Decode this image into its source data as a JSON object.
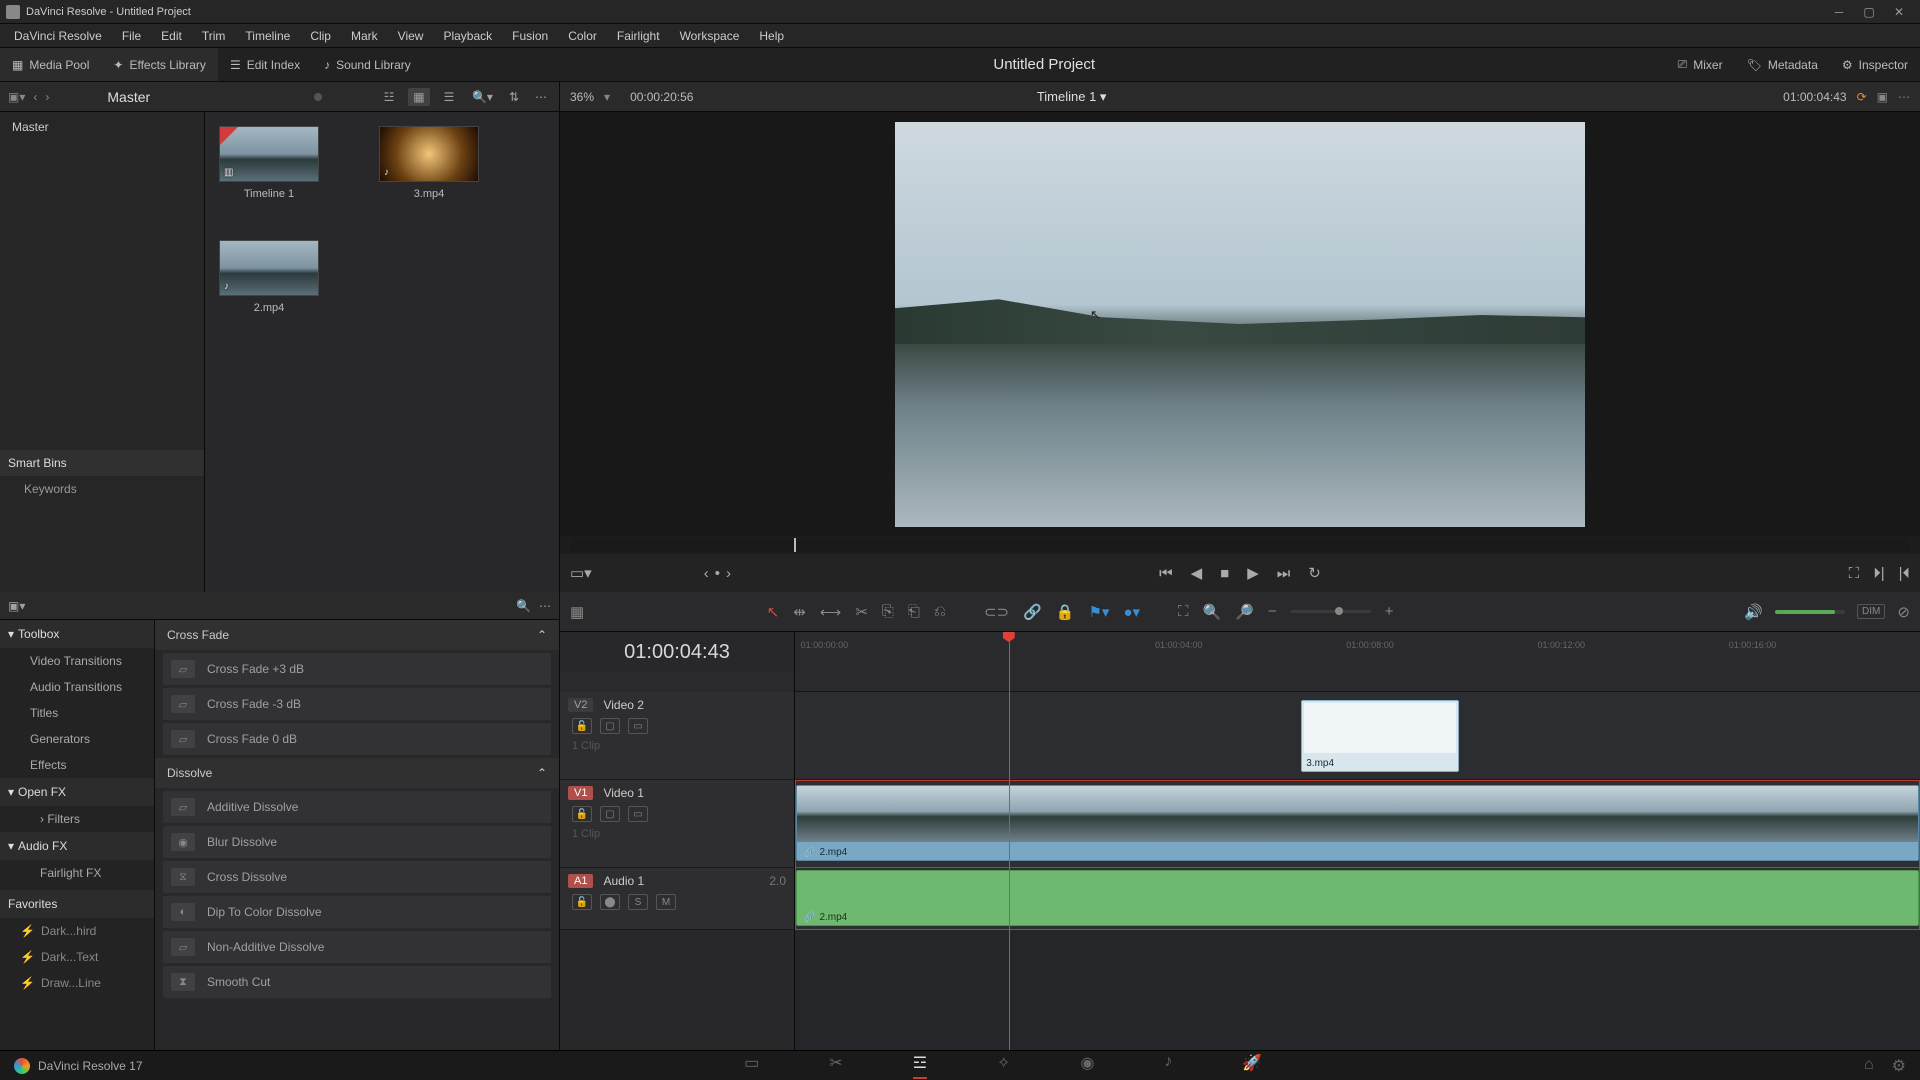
{
  "titlebar": {
    "title": "DaVinci Resolve - Untitled Project"
  },
  "menu": [
    "DaVinci Resolve",
    "File",
    "Edit",
    "Trim",
    "Timeline",
    "Clip",
    "Mark",
    "View",
    "Playback",
    "Fusion",
    "Color",
    "Fairlight",
    "Workspace",
    "Help"
  ],
  "top_toolbar": {
    "media_pool": "Media Pool",
    "effects_library": "Effects Library",
    "edit_index": "Edit Index",
    "sound_library": "Sound Library",
    "project": "Untitled Project",
    "mixer": "Mixer",
    "metadata": "Metadata",
    "inspector": "Inspector"
  },
  "media": {
    "bin": "Master",
    "master_label": "Master",
    "smart_bins": "Smart Bins",
    "keywords": "Keywords",
    "clips": [
      {
        "name": "Timeline 1",
        "kind": "timeline",
        "thumb": "lake"
      },
      {
        "name": "3.mp4",
        "kind": "av",
        "thumb": "tunnel"
      },
      {
        "name": "2.mp4",
        "kind": "av",
        "thumb": "lake"
      }
    ]
  },
  "viewer": {
    "zoom": "36%",
    "duration": "00:00:20:56",
    "timeline_name": "Timeline 1",
    "timecode": "01:00:04:43"
  },
  "fx": {
    "toolbox": "Toolbox",
    "cats": [
      "Video Transitions",
      "Audio Transitions",
      "Titles",
      "Generators",
      "Effects"
    ],
    "openfx": "Open FX",
    "openfx_sub": [
      "Filters"
    ],
    "audiofx": "Audio FX",
    "audiofx_sub": [
      "Fairlight FX"
    ],
    "favorites": "Favorites",
    "fav_items": [
      "Dark...hird",
      "Dark...Text",
      "Draw...Line"
    ],
    "groups": [
      {
        "name": "Cross Fade",
        "items": [
          "Cross Fade +3 dB",
          "Cross Fade -3 dB",
          "Cross Fade 0 dB"
        ]
      },
      {
        "name": "Dissolve",
        "items": [
          "Additive Dissolve",
          "Blur Dissolve",
          "Cross Dissolve",
          "Dip To Color Dissolve",
          "Non-Additive Dissolve",
          "Smooth Cut"
        ]
      }
    ]
  },
  "timeline": {
    "big_tc": "01:00:04:43",
    "ruler": [
      "01:00:00:00",
      "01:00:04:00",
      "01:00:08:00",
      "01:00:12:00",
      "01:00:16:00"
    ],
    "tracks": {
      "v2": {
        "tag": "V2",
        "name": "Video 2",
        "clips_label": "1 Clip"
      },
      "v1": {
        "tag": "V1",
        "name": "Video 1",
        "clips_label": "1 Clip"
      },
      "a1": {
        "tag": "A1",
        "name": "Audio 1",
        "ch": "2.0"
      }
    },
    "clip_v1": "2.mp4",
    "clip_v2": "3.mp4",
    "clip_a1": "2.mp4",
    "mute": "M",
    "solo": "S",
    "dim": "DIM"
  },
  "pagebar": {
    "app": "DaVinci Resolve 17"
  }
}
